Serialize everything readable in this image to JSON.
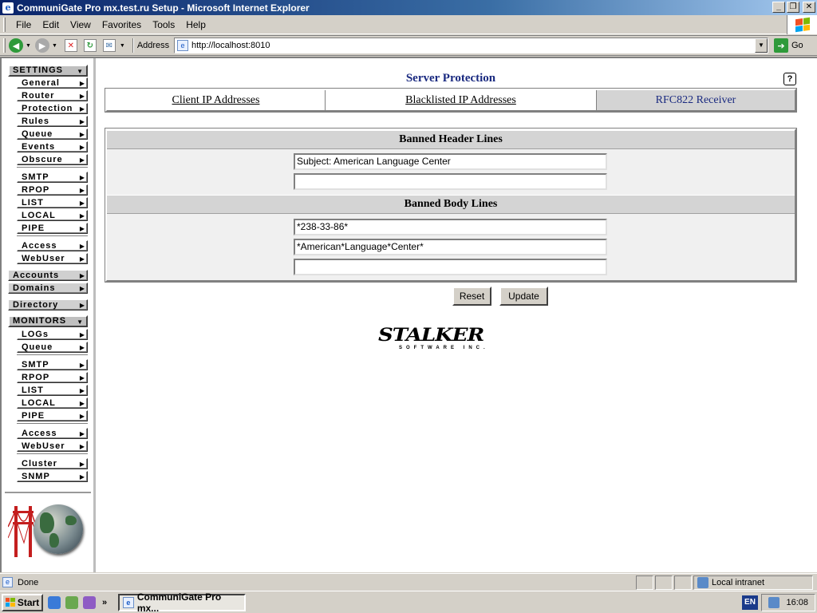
{
  "window": {
    "title": "CommuniGate Pro mx.test.ru Setup - Microsoft Internet Explorer",
    "minimize": "_",
    "maximize": "❐",
    "close": "✕"
  },
  "menu": [
    "File",
    "Edit",
    "View",
    "Favorites",
    "Tools",
    "Help"
  ],
  "address": {
    "label": "Address",
    "url": "http://localhost:8010",
    "go_label": "Go"
  },
  "nav": {
    "settings_header": "SETTINGS",
    "settings_items": [
      "General",
      "Router",
      "Protection",
      "Rules",
      "Queue",
      "Events",
      "Obscure"
    ],
    "module_items": [
      "SMTP",
      "RPOP",
      "LIST",
      "LOCAL",
      "PIPE"
    ],
    "access_items": [
      "Access",
      "WebUser"
    ],
    "accounts": "Accounts",
    "domains": "Domains",
    "directory": "Directory",
    "monitors_header": "MONITORS",
    "monitor_items": [
      "LOGs",
      "Queue"
    ],
    "monitor_modules": [
      "SMTP",
      "RPOP",
      "LIST",
      "LOCAL",
      "PIPE"
    ],
    "monitor_access": [
      "Access",
      "WebUser"
    ],
    "monitor_other": [
      "Cluster",
      "SNMP"
    ]
  },
  "page": {
    "title": "Server Protection",
    "help": "?",
    "tabs": [
      "Client IP Addresses",
      "Blacklisted IP Addresses",
      "RFC822 Receiver"
    ],
    "active_tab": "RFC822 Receiver",
    "header_section": "Banned Header Lines",
    "header_lines": [
      "Subject: American Language Center",
      ""
    ],
    "body_section": "Banned Body Lines",
    "body_lines": [
      "*238-33-86*",
      "*American*Language*Center*",
      ""
    ],
    "reset": "Reset",
    "update": "Update",
    "logo_word": "STALKER",
    "logo_sub": "SOFTWARE INC."
  },
  "status": {
    "text": "Done",
    "zone": "Local intranet"
  },
  "taskbar": {
    "start": "Start",
    "task": "CommuniGate Pro mx...",
    "lang": "EN",
    "clock": "16:08"
  },
  "colors": {
    "title_navy": "#1a2a80",
    "titlebar": "#0a246a"
  }
}
